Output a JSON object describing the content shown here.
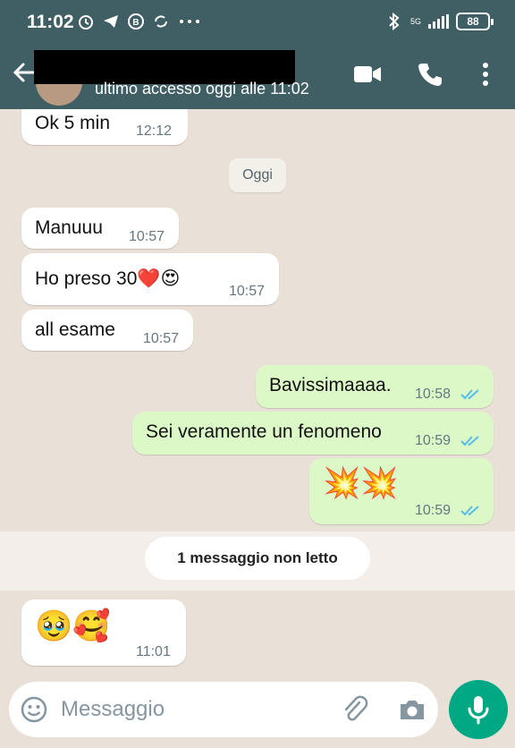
{
  "status_bar": {
    "time": "11:02",
    "network": "5G",
    "battery": "88"
  },
  "header": {
    "last_seen": "ultimo accesso oggi alle 11:02"
  },
  "messages": [
    {
      "dir": "in",
      "text": "Ok 5 min",
      "time": "12:12"
    },
    {
      "dir": "date",
      "text": "Oggi"
    },
    {
      "dir": "in",
      "text": "Manuuu",
      "time": "10:57"
    },
    {
      "dir": "in",
      "text": "Ho preso 30❤️😍",
      "time": "10:57"
    },
    {
      "dir": "in",
      "text": "all esame",
      "time": "10:57"
    },
    {
      "dir": "out",
      "text": "Bavissimaaaa.",
      "time": "10:58",
      "status": "read"
    },
    {
      "dir": "out",
      "text": "Sei veramente un fenomeno",
      "time": "10:59",
      "status": "read"
    },
    {
      "dir": "out",
      "text": "💥💥",
      "time": "10:59",
      "status": "read"
    },
    {
      "dir": "unread",
      "text": "1 messaggio non letto"
    },
    {
      "dir": "in",
      "text": "🥹🥰",
      "time": "11:01"
    }
  ],
  "composer": {
    "placeholder": "Messaggio"
  },
  "icons": {
    "back": "arrow-left-icon",
    "video": "video-call-icon",
    "call": "phone-icon",
    "menu": "more-vert-icon",
    "emoji": "emoji-icon",
    "attach": "paperclip-icon",
    "camera": "camera-icon",
    "mic": "microphone-icon"
  },
  "colors": {
    "header": "#3f5f64",
    "outgoing": "#dcf8c6",
    "incoming": "#ffffff",
    "ticks": "#53bdeb",
    "mic": "#00a884"
  }
}
